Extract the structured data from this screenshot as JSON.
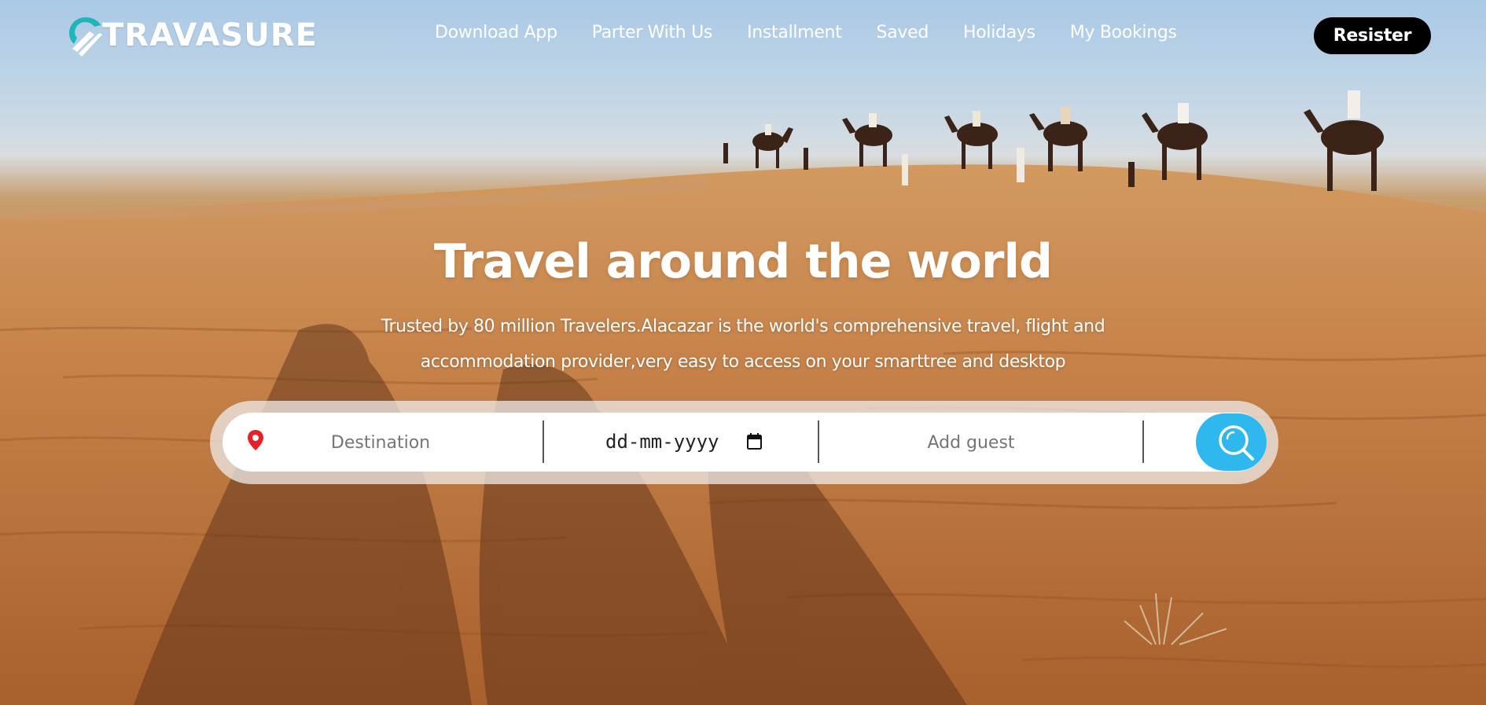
{
  "brand": {
    "name": "TRAVASURE",
    "accent_color": "#1fb6b9"
  },
  "nav": {
    "items": [
      {
        "label": "Download App"
      },
      {
        "label": "Parter With Us"
      },
      {
        "label": "Installment"
      },
      {
        "label": "Saved"
      },
      {
        "label": "Holidays"
      },
      {
        "label": "My Bookings"
      }
    ],
    "register_label": "Resister"
  },
  "hero": {
    "title": "Travel around the world",
    "subtitle": "Trusted by 80 million Travelers.Alacazar is the world's comprehensive travel, flight and accommodation provider,very easy to access on your smarttree and desktop"
  },
  "search": {
    "destination_placeholder": "Destination",
    "date_placeholder": "dd-mm-yyyy",
    "guest_placeholder": "Add guest",
    "button_color": "#2fb8ee",
    "icons": [
      "location-pin-icon",
      "calendar-icon",
      "search-icon"
    ]
  }
}
